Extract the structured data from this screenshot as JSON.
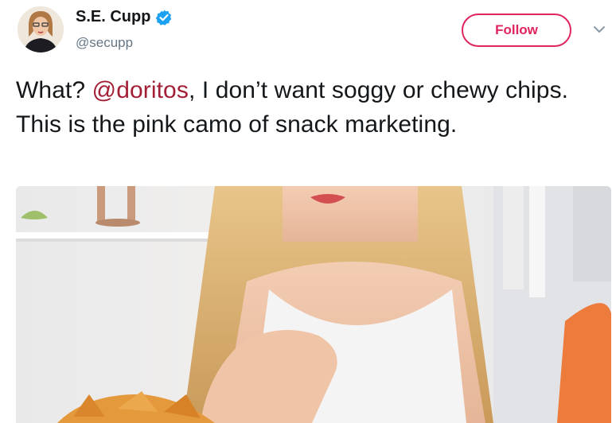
{
  "user": {
    "display_name": "S.E. Cupp",
    "handle": "@secupp",
    "verified": true,
    "avatar_icon": "user-avatar"
  },
  "actions": {
    "follow_label": "Follow",
    "more_icon": "chevron-down-icon"
  },
  "tweet": {
    "text_before": "What? ",
    "mention": "@doritos",
    "text_after": ", I don’t want soggy or chewy chips. This is the pink camo of snack marketing."
  },
  "colors": {
    "follow_accent": "#e0245e",
    "mention": "#a21f35",
    "verified": "#1da1f2",
    "text": "#14171a",
    "muted": "#657786"
  }
}
